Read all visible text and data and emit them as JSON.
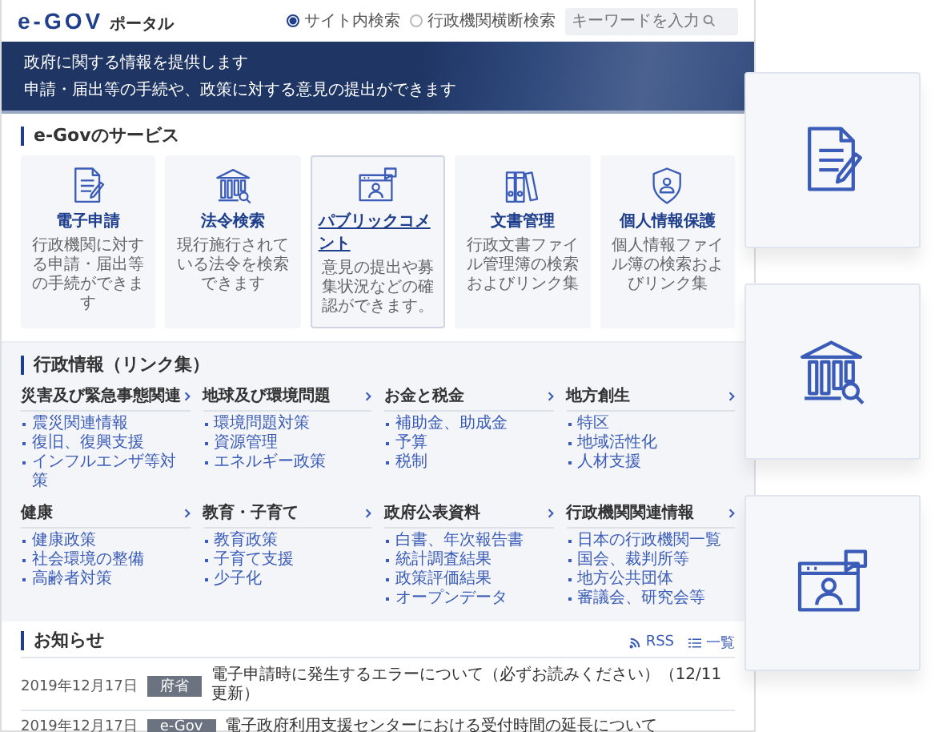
{
  "header": {
    "logo": "e-GOV",
    "logo_suffix": "ポータル",
    "search_scopes": [
      {
        "label": "サイト内検索",
        "selected": true
      },
      {
        "label": "行政機関横断検索",
        "selected": false
      }
    ],
    "search": {
      "placeholder": "キーワードを入力"
    }
  },
  "banner": {
    "lines": [
      "政府に関する情報を提供します",
      "申請・届出等の手続や、政策に対する意見の提出ができます"
    ]
  },
  "services": {
    "title": "e-Govのサービス",
    "items": [
      {
        "kind": "document",
        "title": "電子申請",
        "description": "行政機関に対する申請・届出等の手続ができます",
        "highlighted": false
      },
      {
        "kind": "law",
        "title": "法令検索",
        "description": "現行施行されている法令を検索できます",
        "highlighted": false
      },
      {
        "kind": "comment",
        "title": "パブリックコメント",
        "description": "意見の提出や募集状況などの確認ができます。",
        "highlighted": true
      },
      {
        "kind": "binders",
        "title": "文書管理",
        "description": "行政文書ファイル管理簿の検索およびリンク集",
        "highlighted": false
      },
      {
        "kind": "shield",
        "title": "個人情報保護",
        "description": "個人情報ファイル簿の検索およびリンク集",
        "highlighted": false
      }
    ]
  },
  "links": {
    "title": "行政情報（リンク集）",
    "groups": [
      {
        "heading": "災害及び緊急事態関連",
        "items": [
          "震災関連情報",
          "復旧、復興支援",
          "インフルエンザ等対策"
        ]
      },
      {
        "heading": "地球及び環境問題",
        "items": [
          "環境問題対策",
          "資源管理",
          "エネルギー政策"
        ]
      },
      {
        "heading": "お金と税金",
        "items": [
          "補助金、助成金",
          "予算",
          "税制"
        ]
      },
      {
        "heading": "地方創生",
        "items": [
          "特区",
          "地域活性化",
          "人材支援"
        ]
      },
      {
        "heading": "健康",
        "items": [
          "健康政策",
          "社会環境の整備",
          "高齢者対策"
        ]
      },
      {
        "heading": "教育・子育て",
        "items": [
          "教育政策",
          "子育て支援",
          "少子化"
        ]
      },
      {
        "heading": "政府公表資料",
        "items": [
          "白書、年次報告書",
          "統計調査結果",
          "政策評価結果",
          "オープンデータ"
        ]
      },
      {
        "heading": "行政機関関連情報",
        "items": [
          "日本の行政機関一覧",
          "国会、裁判所等",
          "地方公共団体",
          "審議会、研究会等"
        ]
      }
    ]
  },
  "news": {
    "title": "お知らせ",
    "rss": "RSS",
    "list": "一覧",
    "items": [
      {
        "date": "2019年12月17日",
        "tag": "府省",
        "text": "電子申請時に発生するエラーについて（必ずお読みください）（12/11更新）"
      },
      {
        "date": "2019年12月17日",
        "tag": "e-Gov",
        "text": "電子政府利用支援センターにおける受付時間の延長について"
      }
    ]
  },
  "side_cards": [
    {
      "kind": "document"
    },
    {
      "kind": "law"
    },
    {
      "kind": "comment"
    }
  ]
}
